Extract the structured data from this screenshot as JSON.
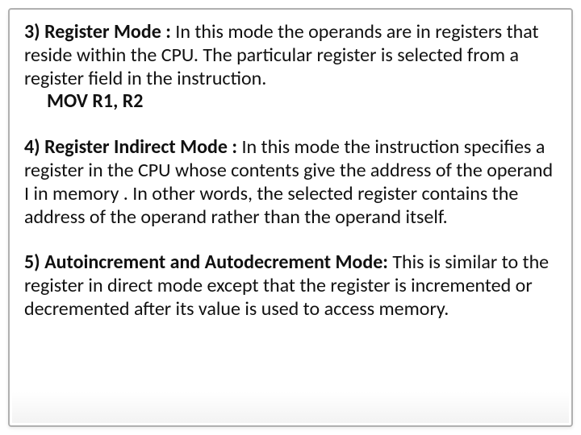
{
  "sections": [
    {
      "heading": "3) Register Mode :",
      "body": " In this mode the operands are in registers that reside within the CPU. The particular register is selected from a register field in the instruction.",
      "example": "MOV R1, R2"
    },
    {
      "heading": "4) Register Indirect Mode :",
      "body": "  In this mode the instruction specifies a register in the CPU whose contents give the address of the operand I in memory . In other words, the selected register contains the address of the operand rather than the operand itself.",
      "example": ""
    },
    {
      "heading": "5) Autoincrement and Autodecrement Mode:",
      "body": " This is similar to the register in direct mode except that the register is incremented or decremented after its value is used to access memory.",
      "example": ""
    }
  ]
}
